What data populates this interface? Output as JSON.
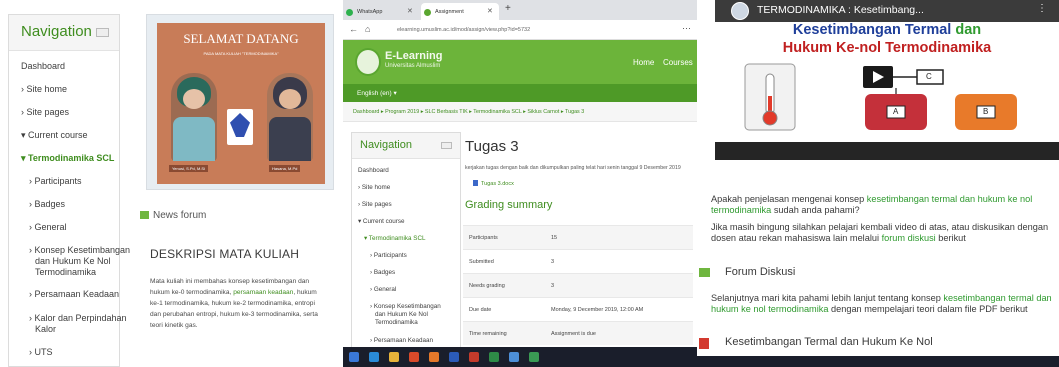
{
  "panel1": {
    "nav": {
      "title": "Navigation",
      "items": [
        {
          "label": "Dashboard"
        },
        {
          "label": "› Site home"
        },
        {
          "label": "› Site pages"
        },
        {
          "label": "▾ Current course"
        },
        {
          "label": "▾ Termodinamika SCL"
        },
        {
          "label": "› Participants"
        },
        {
          "label": "› Badges"
        },
        {
          "label": "› General"
        },
        {
          "label": "› Konsep Kesetimbangan",
          "line2": "dan Hukum Ke Nol",
          "line3": "Termodinamika"
        },
        {
          "label": "› Persamaan Keadaan"
        },
        {
          "label": "› Kalor dan Perpindahan",
          "line2": "Kalor"
        },
        {
          "label": "› UTS"
        }
      ]
    },
    "banner": {
      "title": "SELAMAT DATANG",
      "subtitle": "PADA MATA KULIAH \"TERMODINAMIKA\"",
      "name_left": "Yenusi, S.Pd, M.Si",
      "name_right": "Hasana, M.Pd"
    },
    "forum_label": "News forum",
    "desc_heading": "DESKRIPSI MATA KULIAH",
    "desc_text_1": "Mata kuliah ini membahas konsep kesetimbangan dan hukum ke-0 termodinamika, ",
    "desc_text_green": "persamaan keadaan",
    "desc_text_2": ", hukum ke-1 termodinamika, hukum ke-2 termodinamika, entropi dan perubahan entropi, hukum ke-3 termodinamika, serta teori kinetik gas."
  },
  "panel2": {
    "tabs": [
      {
        "label": "WhatsApp"
      },
      {
        "label": "Assignment"
      }
    ],
    "url": "elearning.umuslim.ac.id/mod/assign/view.php?id=5732",
    "logo_title": "E-Learning",
    "logo_sub": "Universitas Almuslim",
    "header_links": [
      "Home",
      "Courses"
    ],
    "lang": "English (en) ▾",
    "breadcrumb": "Dashboard ▸ Program 2019 ▸ SLC Berbasis TIK ▸ Termodinamika SCL ▸ Siklus Carnot ▸ Tugas 3",
    "nav": {
      "title": "Navigation",
      "items": [
        {
          "label": "Dashboard"
        },
        {
          "label": "› Site home"
        },
        {
          "label": "› Site pages"
        },
        {
          "label": "▾ Current course"
        },
        {
          "label": "▾ Termodinamika SCL"
        },
        {
          "label": "› Participants"
        },
        {
          "label": "› Badges"
        },
        {
          "label": "› General"
        },
        {
          "label": "› Konsep Kesetimbangan",
          "line2": "dan Hukum Ke Nol",
          "line3": "Termodinamika"
        },
        {
          "label": "› Persamaan Keadaan"
        }
      ]
    },
    "assignment_title": "Tugas 3",
    "assignment_desc": "kerjakan tugas dengan baik dan dikumpulkan paling telat hari senin tanggal 9 Desember 2019",
    "file_label": "Tugas 3.docx",
    "grading_heading": "Grading summary",
    "grading_rows": [
      {
        "label": "Participants",
        "value": "15"
      },
      {
        "label": "Submitted",
        "value": "3"
      },
      {
        "label": "Needs grading",
        "value": "3"
      },
      {
        "label": "Due date",
        "value": "Monday, 9 December 2019, 12:00 AM"
      },
      {
        "label": "Time remaining",
        "value": "Assignment is due"
      }
    ]
  },
  "panel3": {
    "video_title": "TERMODINAMIKA : Kesetimbang...",
    "video_heading_1": "Kesetimbangan Termal ",
    "video_heading_1b": "dan",
    "video_heading_2": "Hukum Ke-nol Termodinamika",
    "box_labels": [
      "C",
      "A",
      "B"
    ],
    "para1_a": "Apakah penjelasan mengenai konsep ",
    "para1_g": "kesetimbangan termal dan hukum ke nol termodinamika",
    "para1_b": " sudah anda pahami?",
    "para2_a": "Jika masih bingung silahkan pelajari kembali video di atas, atau diskusikan dengan dosen atau rekan mahasiswa lain melalui ",
    "para2_g": "forum diskusi",
    "para2_b": " berikut",
    "forum_title": "Forum Diskusi",
    "para3_a": "Selanjutnya mari kita pahami lebih lanjut tentang konsep ",
    "para3_g": "kesetimbangan termal dan hukum ke nol termodinamika",
    "para3_b": " dengan mempelajari teori dalam file PDF berikut",
    "pdf_title": "Kesetimbangan Termal dan Hukum Ke Nol"
  }
}
